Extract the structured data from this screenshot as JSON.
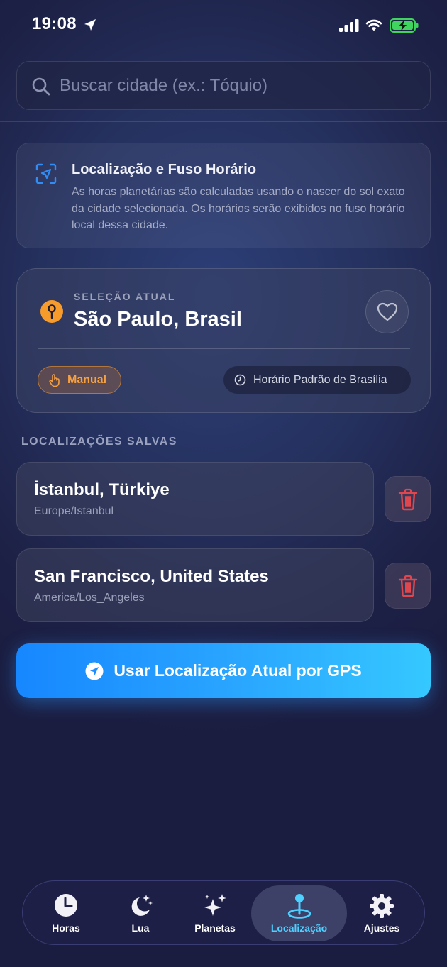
{
  "status_bar": {
    "time": "19:08"
  },
  "search": {
    "placeholder": "Buscar cidade (ex.: Tóquio)"
  },
  "info_card": {
    "title": "Localização e Fuso Horário",
    "text": "As horas planetárias são calculadas usando o nascer do sol exato da cidade selecionada. Os horários serão exibidos no fuso horário local dessa cidade."
  },
  "current_selection": {
    "kicker": "SELEÇÃO ATUAL",
    "city": "São Paulo, Brasil",
    "mode_badge": "Manual",
    "timezone_badge": "Horário Padrão de Brasília"
  },
  "saved_locations": {
    "section_label": "LOCALIZAÇÕES SALVAS",
    "items": [
      {
        "name": "İstanbul, Türkiye",
        "timezone": "Europe/Istanbul"
      },
      {
        "name": "San Francisco, United States",
        "timezone": "America/Los_Angeles"
      }
    ]
  },
  "gps_button": {
    "label": "Usar Localização Atual por GPS"
  },
  "tab_bar": {
    "active": "Localização",
    "tabs": [
      {
        "label": "Horas",
        "icon": "clock-icon"
      },
      {
        "label": "Lua",
        "icon": "moon-icon"
      },
      {
        "label": "Planetas",
        "icon": "sparkles-icon"
      },
      {
        "label": "Localização",
        "icon": "location-pin-icon"
      },
      {
        "label": "Ajustes",
        "icon": "gear-icon"
      }
    ]
  },
  "colors": {
    "accent_blue": "#2aa7ff",
    "active_tab": "#4fd0ff",
    "pin_orange": "#f79c2b",
    "delete_red": "#e0464e"
  }
}
